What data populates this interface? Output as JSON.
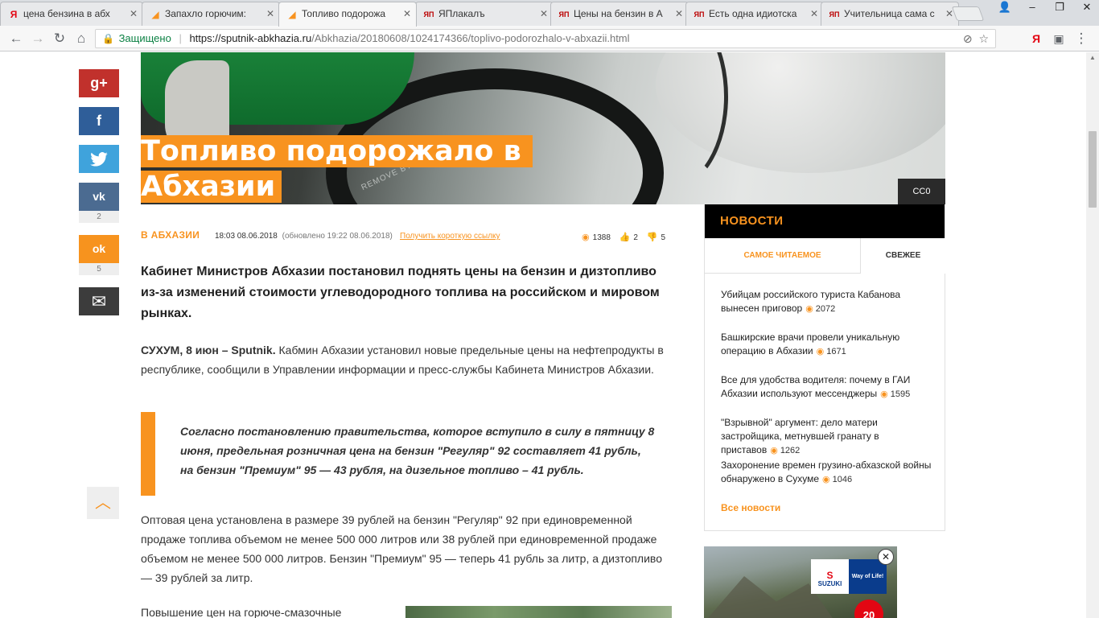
{
  "browser": {
    "tabs": [
      {
        "title": "цена бензина в абх",
        "favicon": "yandex-icon",
        "fav_char": "Я",
        "fav_color": "#e30613"
      },
      {
        "title": "Запахло горючим: ",
        "favicon": "sputnik-icon",
        "fav_char": "◢",
        "fav_color": "#f8931f"
      },
      {
        "title": "Топливо подорожа",
        "favicon": "sputnik-icon",
        "fav_char": "◢",
        "fav_color": "#f8931f",
        "active": true
      },
      {
        "title": "ЯПлакалъ",
        "favicon": "yaplakal-icon",
        "fav_char": "ЯП",
        "fav_color": "#b00"
      },
      {
        "title": "Цены на бензин в А",
        "favicon": "yaplakal-icon",
        "fav_char": "ЯП",
        "fav_color": "#b00"
      },
      {
        "title": "Есть одна идиотска",
        "favicon": "yaplakal-icon",
        "fav_char": "ЯП",
        "fav_color": "#b00"
      },
      {
        "title": "Учительница сама с",
        "favicon": "yaplakal-icon",
        "fav_char": "ЯП",
        "fav_color": "#b00"
      }
    ],
    "secure_label": "Защищено",
    "url_host": "https://sputnik-abkhazia.ru",
    "url_path": "/Abkhazia/20180608/1024174366/toplivo-podorozhalo-v-abxazii.html"
  },
  "article": {
    "title_line1": "Топливо подорожало в",
    "title_line2": "Абхазии",
    "photo_credit": "CC0",
    "section": "В АБХАЗИИ",
    "datetime": "18:03 08.06.2018",
    "updated": "(обновлено 19:22 08.06.2018)",
    "short_link": "Получить короткую ссылку",
    "views": "1388",
    "likes": "2",
    "dislikes": "5",
    "lead": "Кабинет Министров Абхазии постановил поднять цены на бензин и дизтопливо из-за изменений стоимости углеводородного топлива на российском и мировом рынках.",
    "dateline": "СУХУМ, 8 июн – Sputnik.",
    "para1": " Кабмин Абхазии установил новые предельные цены на нефтепродукты в республике, сообщили в Управлении информации и пресс-службы Кабинета Министров Абхазии.",
    "quote": "Согласно постановлению правительства, которое вступило в силу в пятницу 8 июня, предельная розничная цена на бензин \"Регуляр\" 92 составляет 41 рубль, на бензин \"Премиум\" 95 — 43 рубля, на дизельное топливо – 41 рубль.",
    "para2": "Оптовая цена установлена в размере 39 рублей на бензин \"Регуляр\" 92 при единовременной продаже топлива объемом не менее 500 000 литров или 38 рублей при единовременной продаже объемом не менее 500 000 литров.  Бензин \"Премиум\" 95 — теперь 41 рубль за литр, а дизтопливо — 39 рублей за литр.",
    "para3": "Повышение цен на горюче-смазочные"
  },
  "share": {
    "vk_count": "2",
    "ok_count": "5",
    "gplus": "g+",
    "fb": "f",
    "tw": "🐦",
    "vk": "vk",
    "ok": "ok",
    "mail": "✉"
  },
  "news": {
    "heading": "НОВОСТИ",
    "tab_popular": "САМОЕ ЧИТАЕМОЕ",
    "tab_fresh": "СВЕЖЕЕ",
    "items": [
      {
        "title": "Убийцам российского туриста Кабанова вынесен приговор",
        "views": "2072"
      },
      {
        "title": "Башкирские врачи провели уникальную операцию в Абхазии",
        "views": "1671"
      },
      {
        "title": "Все для удобства водителя: почему в ГАИ Абхазии используют мессенджеры",
        "views": "1595"
      },
      {
        "title": "\"Взрывной\" аргумент: дело матери застройщика, метнувшей гранату в приставов",
        "views": "1262"
      },
      {
        "title": "Захоронение времен грузино-абхазской войны обнаружено в Сухуме",
        "views": "1046"
      }
    ],
    "all_news": "Все новости"
  },
  "ad": {
    "brand": "SUZUKI",
    "slogan": "Way of Life!",
    "badge": "20"
  },
  "colors": {
    "accent": "#f8931f",
    "gplus": "#c1312c",
    "facebook": "#2f5e99",
    "twitter": "#3fa3dc",
    "vk": "#4b6b91",
    "ok": "#f7931e",
    "mail": "#3c3c3c"
  }
}
